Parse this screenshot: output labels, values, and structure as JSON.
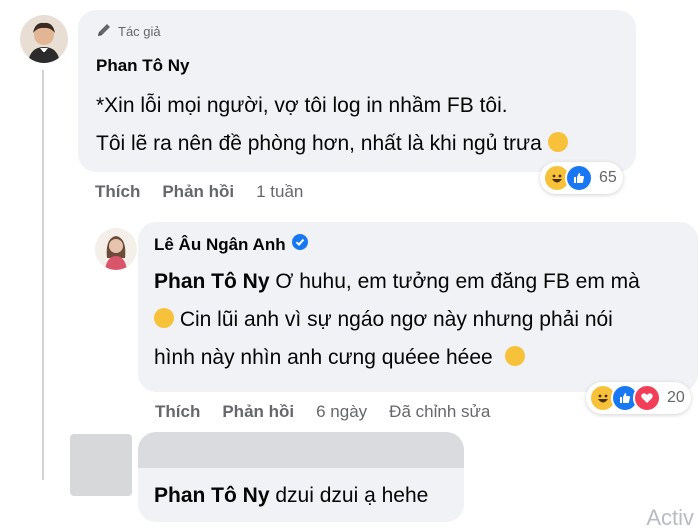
{
  "comment1": {
    "badge_label": "Tác giả",
    "author": "Phan Tô Ny",
    "lines": [
      "*Xin lỗi mọi người, vợ tôi log in nhầm FB tôi.",
      "Tôi lẽ ra nên đề phòng hơn, nhất là khi ngủ trưa"
    ],
    "like": "Thích",
    "reply": "Phản hồi",
    "time": "1 tuần",
    "reaction_count": "65"
  },
  "comment2": {
    "author": "Lê Âu Ngân Anh",
    "mention": "Phan Tô Ny",
    "line1_rest": " Ơ huhu, em tưởng em đăng FB em mà",
    "line2": " Cin lũi anh vì sự ngáo ngơ này nhưng phải nói",
    "line3": "hình này nhìn anh cưng quéee héee",
    "like": "Thích",
    "reply": "Phản hồi",
    "time": "6 ngày",
    "edited": "Đã chỉnh sửa",
    "reaction_count": "20"
  },
  "comment3": {
    "mention": "Phan Tô Ny",
    "text": " dzui dzui ạ hehe"
  },
  "footer": {
    "partial_action": "Activ"
  },
  "colors": {
    "bubble": "#f0f2f5",
    "muted": "#65676b",
    "verified": "#1877f2",
    "like_blue": "#1877f2",
    "haha_yellow": "#f7c23a",
    "love_red": "#f33e58"
  }
}
